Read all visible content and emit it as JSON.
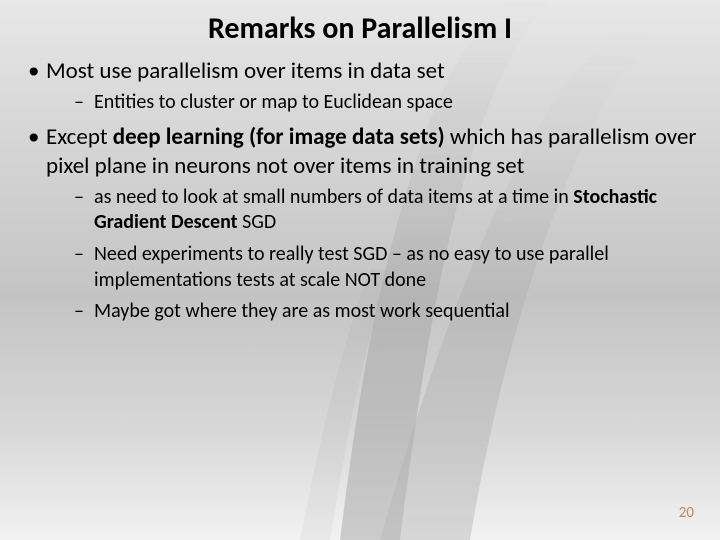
{
  "slide": {
    "title": "Remarks on Parallelism I",
    "page_number": "20",
    "items": [
      {
        "prefix": "Most use parallelism over items in data set",
        "bold": "",
        "suffix": "",
        "sub": [
          {
            "prefix": "Entities to cluster or map to Euclidean space",
            "bold": "",
            "suffix": ""
          }
        ]
      },
      {
        "prefix": "Except ",
        "bold": "deep learning (for image data sets)",
        "suffix": " which has parallelism over pixel plane in neurons not over items in training set",
        "sub": [
          {
            "prefix": "as need to look at small numbers of data items at a time in ",
            "bold": "Stochastic Gradient Descent",
            "suffix": " SGD"
          },
          {
            "prefix": "Need experiments to really test SGD – as no easy to use parallel implementations tests at scale NOT done",
            "bold": "",
            "suffix": ""
          },
          {
            "prefix": "Maybe got where they are as most work sequential",
            "bold": "",
            "suffix": ""
          }
        ]
      }
    ]
  }
}
